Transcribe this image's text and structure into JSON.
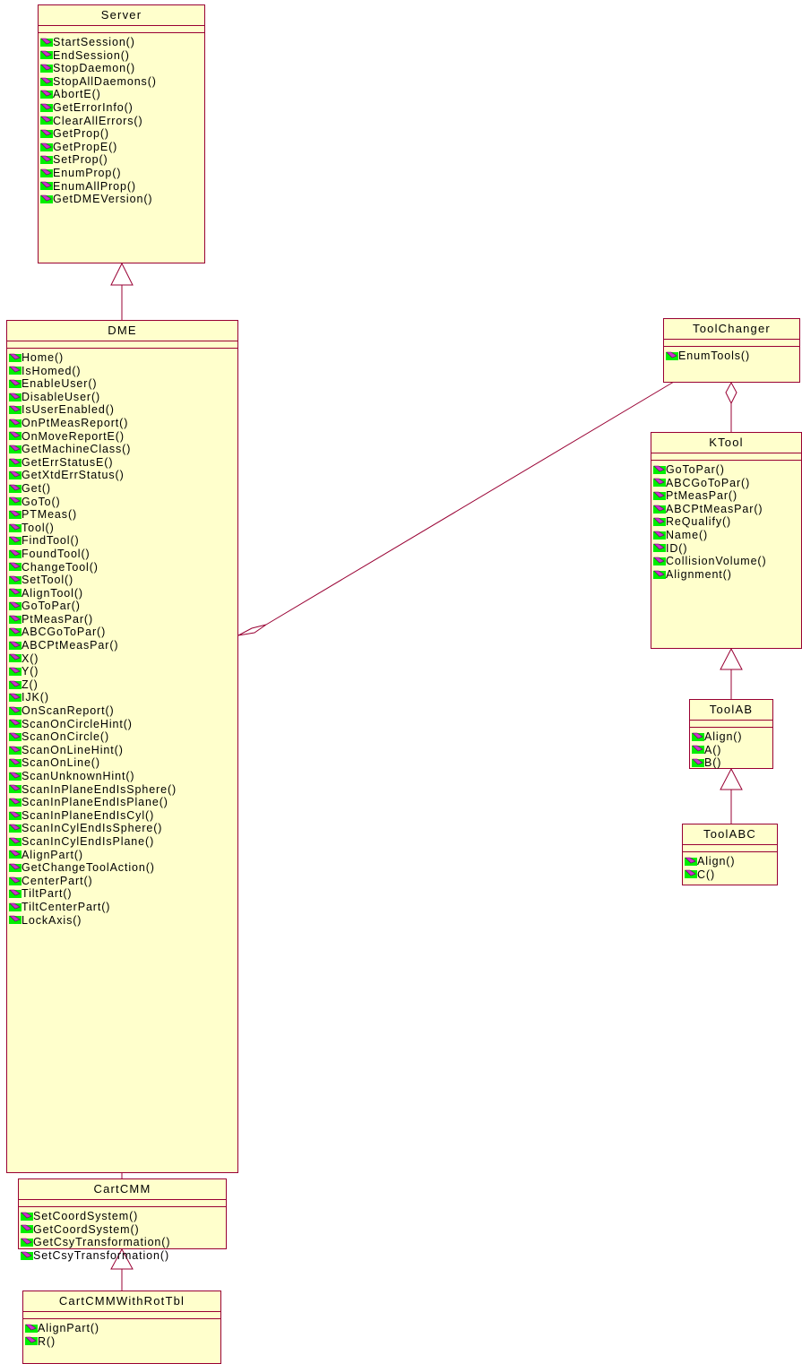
{
  "classes": {
    "server": {
      "name": "Server",
      "operations": [
        "StartSession()",
        "EndSession()",
        "StopDaemon()",
        "StopAllDaemons()",
        "AbortE()",
        "GetErrorInfo()",
        "ClearAllErrors()",
        "GetProp()",
        "GetPropE()",
        "SetProp()",
        "EnumProp()",
        "EnumAllProp()",
        "GetDMEVersion()"
      ]
    },
    "dme": {
      "name": "DME",
      "operations": [
        "Home()",
        "IsHomed()",
        "EnableUser()",
        "DisableUser()",
        "IsUserEnabled()",
        "OnPtMeasReport()",
        "OnMoveReportE()",
        "GetMachineClass()",
        "GetErrStatusE()",
        "GetXtdErrStatus()",
        "Get()",
        "GoTo()",
        "PTMeas()",
        "Tool()",
        "FindTool()",
        "FoundTool()",
        "ChangeTool()",
        "SetTool()",
        "AlignTool()",
        "GoToPar()",
        "PtMeasPar()",
        "ABCGoToPar()",
        "ABCPtMeasPar()",
        "X()",
        "Y()",
        "Z()",
        "IJK()",
        "OnScanReport()",
        "ScanOnCircleHint()",
        "ScanOnCircle()",
        "ScanOnLineHint()",
        "ScanOnLine()",
        "ScanUnknownHint()",
        "ScanInPlaneEndIsSphere()",
        "ScanInPlaneEndIsPlane()",
        "ScanInPlaneEndIsCyl()",
        "ScanInCylEndIsSphere()",
        "ScanInCylEndIsPlane()",
        "AlignPart()",
        "GetChangeToolAction()",
        "CenterPart()",
        "TiltPart()",
        "TiltCenterPart()",
        "LockAxis()"
      ]
    },
    "cartcmm": {
      "name": "CartCMM",
      "operations": [
        "SetCoordSystem()",
        "GetCoordSystem()",
        "GetCsyTransformation()",
        "SetCsyTransformation()"
      ]
    },
    "cartcmm_rottbl": {
      "name": "CartCMMWithRotTbl",
      "operations": [
        "AlignPart()",
        "R()"
      ]
    },
    "toolchanger": {
      "name": "ToolChanger",
      "operations": [
        "EnumTools()"
      ]
    },
    "ktool": {
      "name": "KTool",
      "operations": [
        "GoToPar()",
        "ABCGoToPar()",
        "PtMeasPar()",
        "ABCPtMeasPar()",
        "ReQualify()",
        "Name()",
        "ID()",
        "CollisionVolume()",
        "Alignment()"
      ]
    },
    "toolab": {
      "name": "ToolAB",
      "operations": [
        "Align()",
        "A()",
        "B()"
      ]
    },
    "toolabc": {
      "name": "ToolABC",
      "operations": [
        "Align()",
        "C()"
      ]
    }
  },
  "colors": {
    "box_fill": "#ffffcc",
    "box_border": "#990033",
    "icon_green": "#00ee00",
    "icon_magenta": "#cc33cc"
  }
}
